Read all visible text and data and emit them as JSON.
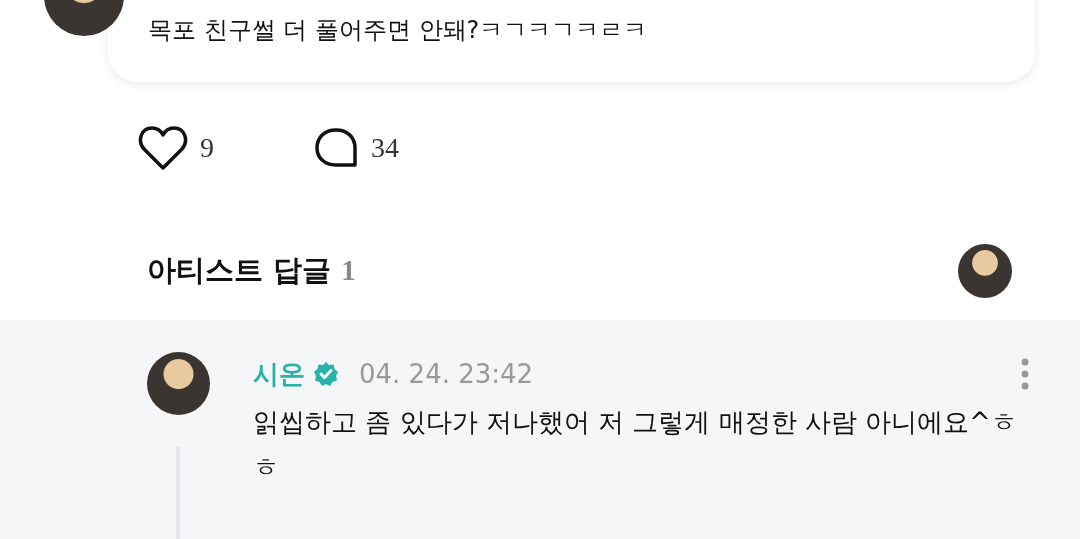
{
  "post": {
    "text": "목포 친구썰 더 풀어주면 안돼?ㅋㄱㅋㄱㅋㄹㅋ",
    "likes": "9",
    "comments": "34"
  },
  "artist_replies": {
    "title": "아티스트 답글",
    "count": "1"
  },
  "reply": {
    "author": "시온",
    "verified": true,
    "time": "04. 24. 23:42",
    "text": "읽씹하고 좀 있다가 저나했어 저 그렇게 매정한 사람 아니에요^ㅎㅎ"
  }
}
